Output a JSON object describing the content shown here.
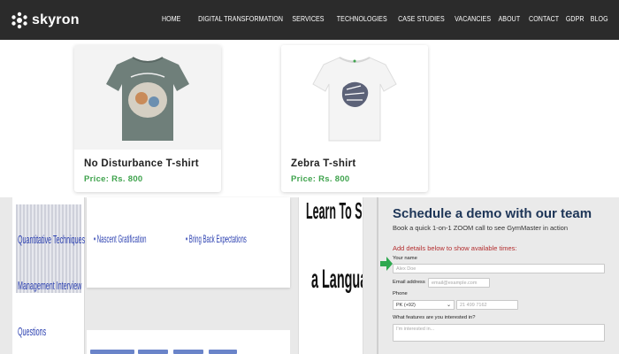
{
  "header": {
    "brand": "skyron",
    "nav": [
      "HOME",
      "DIGITAL TRANSFORMATION",
      "SERVICES",
      "TECHNOLOGIES",
      "CASE STUDIES",
      "VACANCIES",
      "ABOUT",
      "CONTACT",
      "GDPR",
      "BLOG"
    ]
  },
  "products": [
    {
      "title": "No Disturbance T-shirt",
      "price": "Price: Rs. 800",
      "shirt_color": "#6f7f7a"
    },
    {
      "title": "Zebra T-shirt",
      "price": "Price: Rs. 800",
      "shirt_color": "#f7f7f7"
    }
  ],
  "collage": {
    "left_lines": [
      "Quantitative Techniques For",
      "Management Interview",
      "Questions"
    ],
    "mid_items": [
      "• Nascent Gratification",
      "• Bring Back Expectations"
    ],
    "lang_lines": [
      "Learn To Speak",
      "a Language"
    ]
  },
  "demo": {
    "title": "Schedule a demo with our team",
    "subtitle": "Book a quick 1-on-1 ZOOM call to see GymMaster in action",
    "add_details": "Add details below to show available times:",
    "name_label": "Your name",
    "name_placeholder": "Alex Doe",
    "email_label": "Email address",
    "email_placeholder": "email@example.com",
    "phone_label": "Phone",
    "phone_country": "PK (+92)",
    "phone_placeholder": "21 499 7162",
    "features_label": "What features are you interested in?",
    "features_placeholder": "I'm interested in..."
  },
  "colors": {
    "accent_green": "#3fa34d",
    "heading_blue": "#1d3557",
    "header_bg": "#2b2b2b"
  }
}
